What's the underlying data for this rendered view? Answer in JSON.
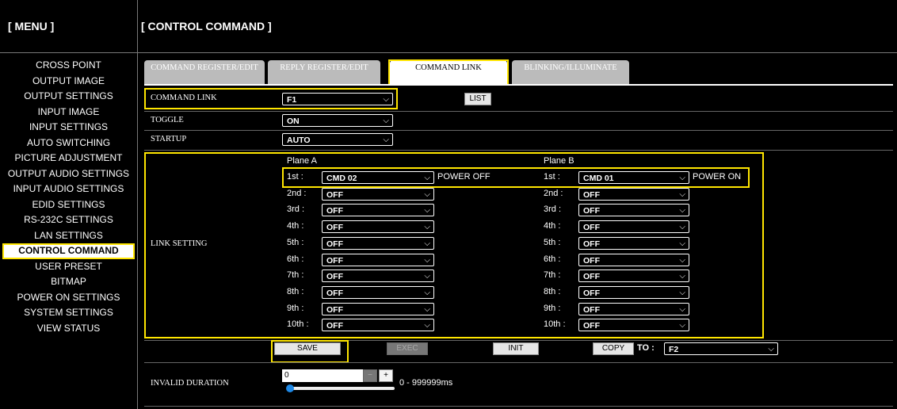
{
  "sidebar": {
    "title": "[ MENU ]",
    "items": [
      {
        "label": "CROSS POINT"
      },
      {
        "label": "OUTPUT IMAGE"
      },
      {
        "label": "OUTPUT SETTINGS"
      },
      {
        "label": "INPUT IMAGE"
      },
      {
        "label": "INPUT SETTINGS"
      },
      {
        "label": "AUTO SWITCHING"
      },
      {
        "label": "PICTURE ADJUSTMENT"
      },
      {
        "label": "OUTPUT AUDIO SETTINGS"
      },
      {
        "label": "INPUT AUDIO SETTINGS"
      },
      {
        "label": "EDID SETTINGS"
      },
      {
        "label": "RS-232C SETTINGS"
      },
      {
        "label": "LAN SETTINGS"
      },
      {
        "label": "CONTROL COMMAND"
      },
      {
        "label": "USER PRESET"
      },
      {
        "label": "BITMAP"
      },
      {
        "label": "POWER ON SETTINGS"
      },
      {
        "label": "SYSTEM SETTINGS"
      },
      {
        "label": "VIEW STATUS"
      }
    ],
    "active_index": 12
  },
  "header": {
    "title": "[ CONTROL COMMAND ]"
  },
  "tabs": [
    {
      "label": "COMMAND REGISTER/EDIT"
    },
    {
      "label": "REPLY REGISTER/EDIT"
    },
    {
      "label": "COMMAND LINK"
    },
    {
      "label": "BLINKING/ILLUMINATE"
    }
  ],
  "form": {
    "command_link_label": "COMMAND LINK",
    "command_link_value": "F1",
    "list_button": "LIST",
    "toggle_label": "TOGGLE",
    "toggle_value": "ON",
    "startup_label": "STARTUP",
    "startup_value": "AUTO",
    "link_setting_label": "LINK SETTING",
    "plane_a_title": "Plane A",
    "plane_b_title": "Plane B",
    "plane_a": [
      {
        "ord": "1st :",
        "value": "CMD 02",
        "note": "POWER OFF"
      },
      {
        "ord": "2nd :",
        "value": "OFF",
        "note": ""
      },
      {
        "ord": "3rd :",
        "value": "OFF",
        "note": ""
      },
      {
        "ord": "4th :",
        "value": "OFF",
        "note": ""
      },
      {
        "ord": "5th :",
        "value": "OFF",
        "note": ""
      },
      {
        "ord": "6th :",
        "value": "OFF",
        "note": ""
      },
      {
        "ord": "7th :",
        "value": "OFF",
        "note": ""
      },
      {
        "ord": "8th :",
        "value": "OFF",
        "note": ""
      },
      {
        "ord": "9th :",
        "value": "OFF",
        "note": ""
      },
      {
        "ord": "10th :",
        "value": "OFF",
        "note": ""
      }
    ],
    "plane_b": [
      {
        "ord": "1st :",
        "value": "CMD 01",
        "note": "POWER ON"
      },
      {
        "ord": "2nd :",
        "value": "OFF",
        "note": ""
      },
      {
        "ord": "3rd :",
        "value": "OFF",
        "note": ""
      },
      {
        "ord": "4th :",
        "value": "OFF",
        "note": ""
      },
      {
        "ord": "5th :",
        "value": "OFF",
        "note": ""
      },
      {
        "ord": "6th :",
        "value": "OFF",
        "note": ""
      },
      {
        "ord": "7th :",
        "value": "OFF",
        "note": ""
      },
      {
        "ord": "8th :",
        "value": "OFF",
        "note": ""
      },
      {
        "ord": "9th :",
        "value": "OFF",
        "note": ""
      },
      {
        "ord": "10th :",
        "value": "OFF",
        "note": ""
      }
    ],
    "save_button": "SAVE",
    "exec_button": "EXEC",
    "init_button": "INIT",
    "copy_button": "COPY",
    "to_label": "TO :",
    "copy_to_value": "F2",
    "invalid_duration_label": "INVALID DURATION",
    "invalid_duration_value": "0",
    "minus_label": "−",
    "plus_label": "+",
    "invalid_duration_range": "0 - 999999ms",
    "slider_level": 0
  },
  "colors": {
    "highlight": "#ffe600",
    "background": "#000000"
  },
  "icons": {
    "dropdown": "chevron-down-icon"
  }
}
